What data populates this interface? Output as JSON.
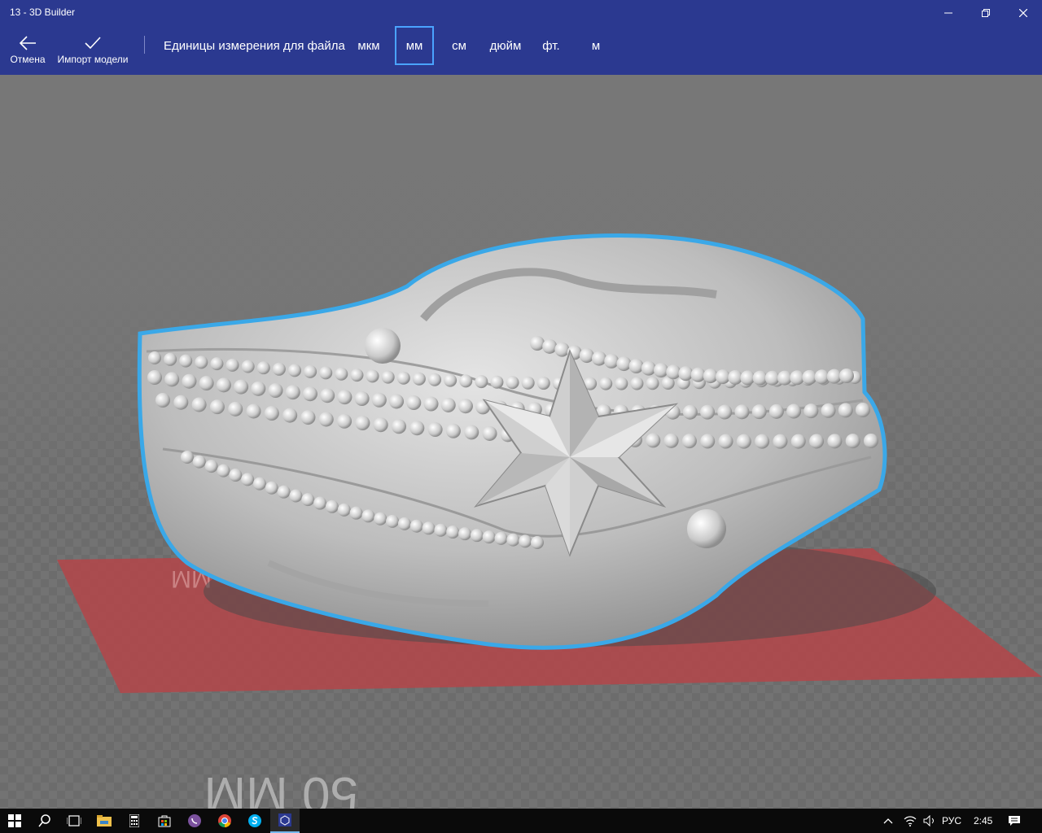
{
  "window": {
    "title": "13 - 3D Builder",
    "minimize_icon": "minimize-icon",
    "restore_icon": "restore-icon",
    "close_icon": "close-icon"
  },
  "toolbar": {
    "cancel_label": "Отмена",
    "cancel_icon": "arrow-left-icon",
    "import_label": "Импорт модели",
    "import_icon": "checkmark-icon",
    "units_label": "Единицы измерения для файла",
    "units": [
      "мкм",
      "мм",
      "см",
      "дюйм",
      "фт.",
      "м"
    ],
    "selected_unit": "мм"
  },
  "viewport": {
    "plate_label_back": "MM",
    "plate_label_front": "50 MM",
    "selection_color": "#3aa8e8",
    "plate_color": "#b0484b"
  },
  "taskbar": {
    "icons": [
      "windows-start-icon",
      "search-icon",
      "task-view-icon",
      "file-explorer-icon",
      "calculator-icon",
      "store-icon",
      "viber-icon",
      "chrome-icon",
      "skype-icon",
      "3d-builder-icon"
    ],
    "language": "РУС",
    "time": "2:45"
  }
}
